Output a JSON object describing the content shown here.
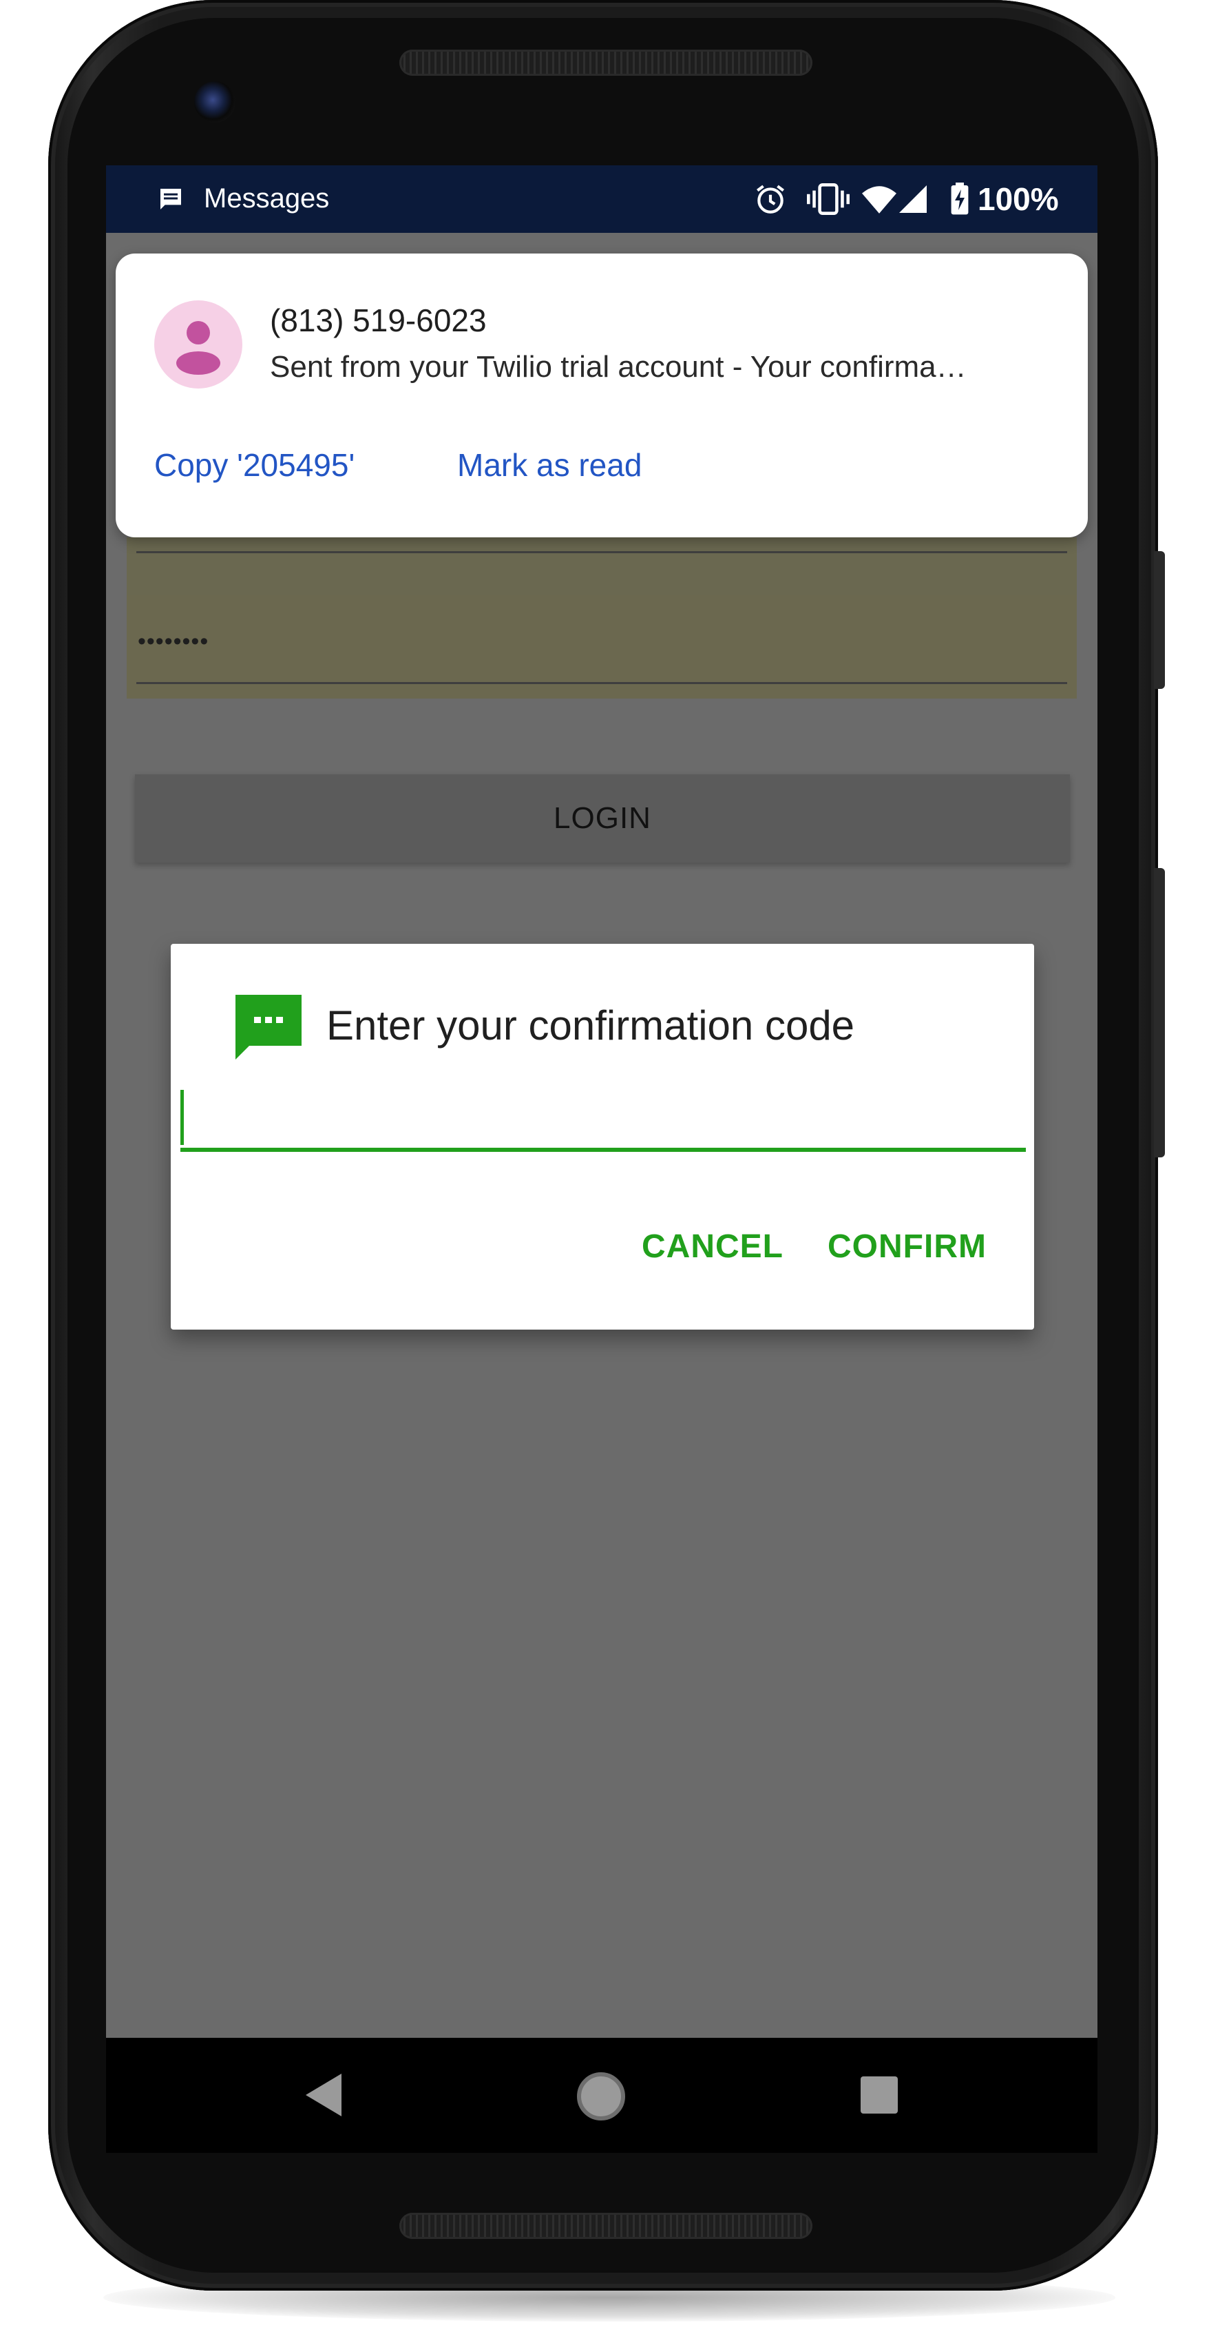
{
  "status_bar": {
    "app_icon": "messages-icon",
    "app_label": "Messages",
    "icons": [
      "alarm-icon",
      "vibrate-icon",
      "wifi-icon",
      "signal-icon",
      "battery-charging-icon"
    ],
    "battery_percent": "100%",
    "background_color": "#0b1a3a"
  },
  "notification": {
    "sender": "(813) 519-6023",
    "message": "Sent from your Twilio trial account - Your confirma…",
    "avatar_icon": "contact-avatar-icon",
    "actions": {
      "copy_label": "Copy '205495'",
      "mark_read_label": "Mark as read"
    },
    "action_color": "#2255c4"
  },
  "login_form": {
    "password_masked": "••••••••",
    "login_label": "LOGIN"
  },
  "dialog": {
    "icon": "message-icon",
    "title": "Enter your confirmation code",
    "input_value": "",
    "cancel_label": "CANCEL",
    "confirm_label": "CONFIRM",
    "accent_color": "#21a01c"
  },
  "nav_bar": {
    "icons": [
      "back-icon",
      "home-icon",
      "recents-icon"
    ]
  }
}
